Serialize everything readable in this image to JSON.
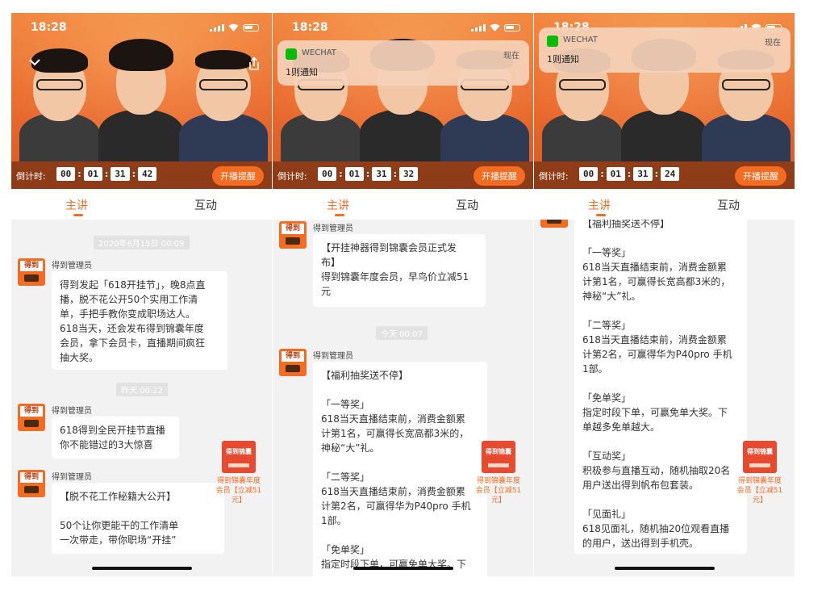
{
  "screens": [
    {
      "status_time": "18:28",
      "countdown": {
        "label": "倒计时:",
        "h": "00",
        "m": "01",
        "s": "31",
        "f": "42"
      },
      "remind_button": "开播提醒",
      "tabs": [
        "主讲",
        "互动"
      ],
      "timestamps": [
        "2020年6月15日 00:09",
        "昨天 00:22"
      ],
      "messages": [
        {
          "sender": "得到管理员",
          "text": "得到发起「618开挂节」，晚8点直\n播，脱不花公开50个实用工作清\n单，手把手教你变成职场达人。\n618当天，还会发布得到锦囊年度\n会员，拿下会员卡，直播期间疯狂\n抽大奖。"
        },
        {
          "sender": "得到管理员",
          "text": "618得到全民开挂节直播\n你不能错过的3大惊喜"
        },
        {
          "sender": "得到管理员",
          "text": "【脱不花工作秘籍大公开】\n\n50个让你更能干的工作清单\n一次带走，带你职场“开挂”"
        }
      ],
      "promo": "得到锦囊年度会员【立减51元】"
    },
    {
      "status_time": "18:28",
      "notification": {
        "app": "WECHAT",
        "time": "现在",
        "body": "1则通知"
      },
      "countdown": {
        "label": "倒计时:",
        "h": "00",
        "m": "01",
        "s": "31",
        "f": "32"
      },
      "remind_button": "开播提醒",
      "tabs": [
        "主讲",
        "互动"
      ],
      "timestamps": [
        "今天 00:07"
      ],
      "messages": [
        {
          "sender": "得到管理员",
          "text": "【开挂神器得到锦囊会员正式发\n布】\n得到锦囊年度会员，早鸟价立减51\n元"
        },
        {
          "sender": "得到管理员",
          "text": "【福利抽奖送不停】\n\n「一等奖」\n618当天直播结束前，消费金额累\n计第1名，可赢得长宽高都3米的，\n神秘“大”礼。\n\n「二等奖」\n618当天直播结束前，消费金额累\n计第2名，可赢得华为P40pro 手机\n1部。\n\n「免单奖」\n指定时段下单，可赢免单大奖。下"
        }
      ],
      "promo": "得到锦囊年度会员【立减51元】"
    },
    {
      "status_time": "18:28",
      "notification": {
        "app": "WECHAT",
        "time": "现在",
        "body": "1则通知"
      },
      "countdown": {
        "label": "倒计时:",
        "h": "00",
        "m": "01",
        "s": "31",
        "f": "24"
      },
      "remind_button": "开播提醒",
      "tabs": [
        "主讲",
        "互动"
      ],
      "messages": [
        {
          "sender": "",
          "text": "【福利抽奖送不停】\n\n「一等奖」\n618当天直播结束前，消费金额累\n计第1名，可赢得长宽高都3米的，\n神秘“大”礼。\n\n「二等奖」\n618当天直播结束前，消费金额累\n计第2名，可赢得华为P40pro 手机\n1部。\n\n「免单奖」\n指定时段下单，可赢免单大奖。下\n单越多免单越大。\n\n「互动奖」\n积极参与直播互动，随机抽取20名\n用户送出得到帆布包套装。\n\n「见面礼」\n618见面礼，随机抽20位观看直播\n的用户，送出得到手机壳。"
        }
      ],
      "promo": "得到锦囊年度会员【立减51元】"
    }
  ],
  "avatar_text": "得到",
  "promo_img_text": "得到锦囊",
  "colors": {
    "accent": "#f46c21",
    "hero": "#e8672c",
    "wechat": "#09bb07"
  }
}
